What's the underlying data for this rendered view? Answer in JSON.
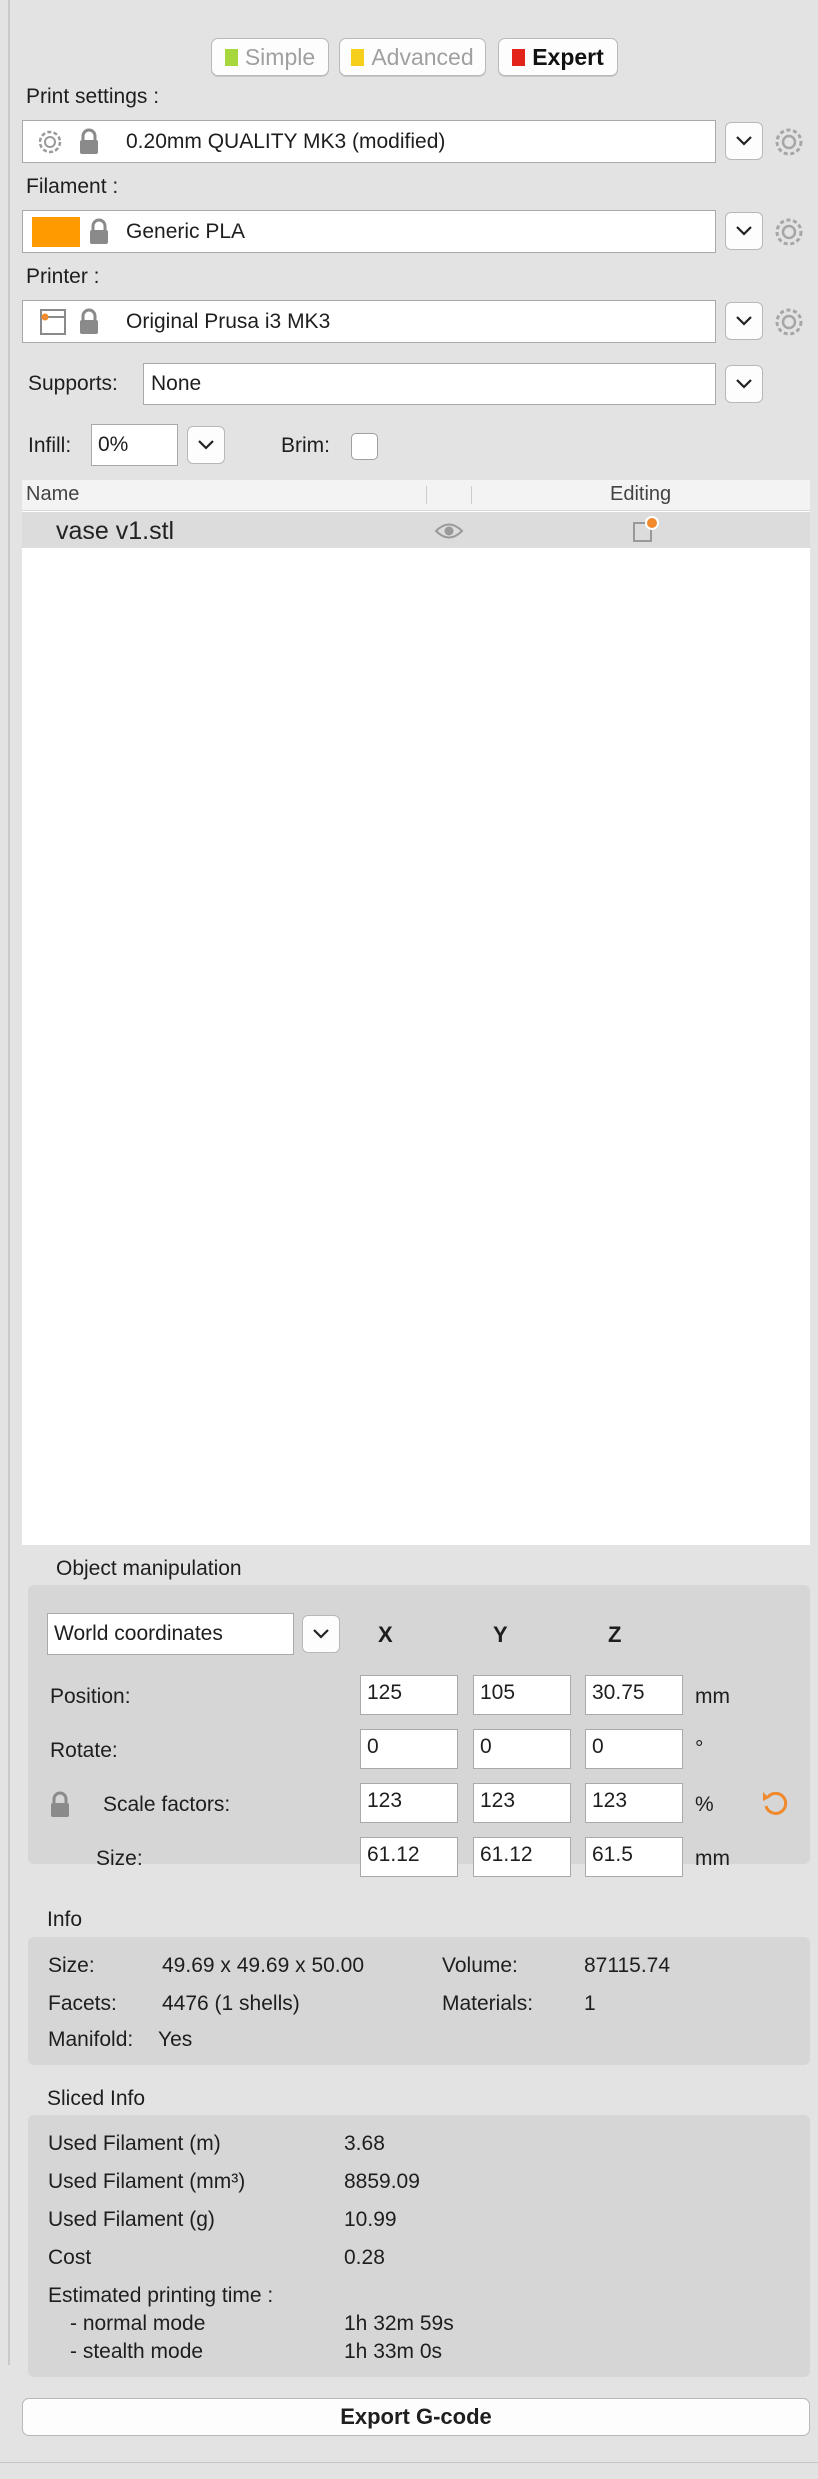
{
  "modes": [
    {
      "label": "Simple",
      "color": "#a6d73c",
      "active": false
    },
    {
      "label": "Advanced",
      "color": "#f6cf1c",
      "active": false
    },
    {
      "label": "Expert",
      "color": "#e3241b",
      "active": true
    }
  ],
  "print_settings": {
    "label": "Print settings :",
    "value": "0.20mm QUALITY MK3 (modified)"
  },
  "filament": {
    "label": "Filament :",
    "value": "Generic PLA",
    "swatch_color": "#ff9a00"
  },
  "printer": {
    "label": "Printer :",
    "value": "Original Prusa i3 MK3"
  },
  "supports": {
    "label": "Supports:",
    "value": "None"
  },
  "infill": {
    "label": "Infill:",
    "value": "0%"
  },
  "brim": {
    "label": "Brim:",
    "checked": false
  },
  "object_list": {
    "columns": {
      "name": "Name",
      "editing": "Editing"
    },
    "items": [
      {
        "name": "vase v1.stl"
      }
    ]
  },
  "object_manipulation": {
    "title": "Object manipulation",
    "coordinate_system": "World coordinates",
    "axes": [
      "X",
      "Y",
      "Z"
    ],
    "rows": [
      {
        "label": "Position:",
        "values": [
          "125",
          "105",
          "30.75"
        ],
        "unit": "mm"
      },
      {
        "label": "Rotate:",
        "values": [
          "0",
          "0",
          "0"
        ],
        "unit": "°"
      },
      {
        "label": "Scale factors:",
        "values": [
          "123",
          "123",
          "123"
        ],
        "unit": "%"
      },
      {
        "label": "Size:",
        "values": [
          "61.12",
          "61.12",
          "61.5"
        ],
        "unit": "mm"
      }
    ]
  },
  "info": {
    "title": "Info",
    "size_label": "Size:",
    "size_value": "49.69 x 49.69 x 50.00",
    "volume_label": "Volume:",
    "volume_value": "87115.74",
    "facets_label": "Facets:",
    "facets_value": "4476 (1 shells)",
    "materials_label": "Materials:",
    "materials_value": "1",
    "manifold_label": "Manifold:",
    "manifold_value": "Yes"
  },
  "sliced_info": {
    "title": "Sliced Info",
    "rows": [
      {
        "label": "Used Filament (m)",
        "value": "3.68"
      },
      {
        "label": "Used Filament (mm³)",
        "value": "8859.09"
      },
      {
        "label": "Used Filament (g)",
        "value": "10.99"
      },
      {
        "label": "Cost",
        "value": "0.28"
      }
    ],
    "time_label": "Estimated printing time :",
    "normal_label": "- normal mode",
    "normal_value": "1h 32m 59s",
    "stealth_label": "- stealth mode",
    "stealth_value": "1h 33m 0s"
  },
  "export_label": "Export G-code",
  "colors": {
    "accent": "#f08a2c"
  }
}
